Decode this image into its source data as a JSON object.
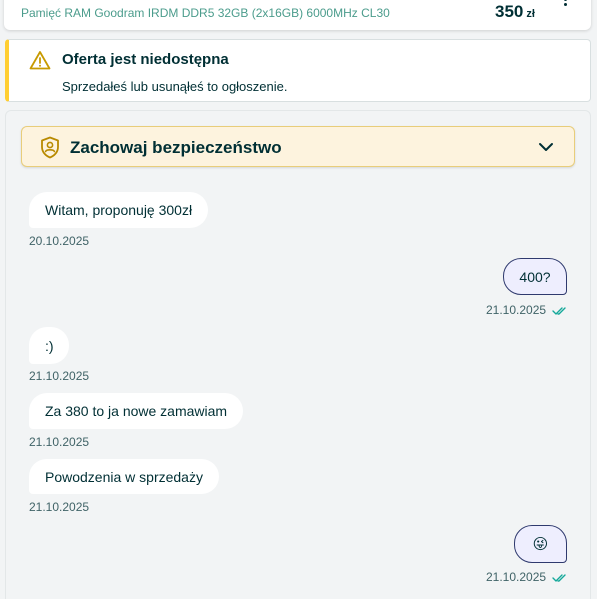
{
  "offer": {
    "title": "Pamięć RAM Goodram IRDM DDR5 32GB (2x16GB) 6000MHz CL30",
    "price": "350",
    "currency": "zł"
  },
  "notice": {
    "title": "Oferta jest niedostępna",
    "text": "Sprzedałeś lub usunąłeś to ogłoszenie."
  },
  "safety": {
    "title": "Zachowaj bezpieczeństwo"
  },
  "messages": [
    {
      "direction": "incoming",
      "text": "Witam, proponuję 300zł",
      "date": "20.10.2025"
    },
    {
      "direction": "outgoing",
      "text": "400?",
      "date": "21.10.2025",
      "read": true
    },
    {
      "direction": "incoming",
      "text": ":)",
      "date": "21.10.2025"
    },
    {
      "direction": "incoming",
      "text": "Za 380 to ja nowe zamawiam",
      "date": "21.10.2025"
    },
    {
      "direction": "incoming",
      "text": "Powodzenia w sprzedaży",
      "date": "21.10.2025"
    },
    {
      "direction": "outgoing",
      "text": "😜",
      "date": "21.10.2025",
      "read": true
    }
  ],
  "colors": {
    "accent_teal": "#4b9c8c",
    "warning_yellow": "#ffce32",
    "outgoing_bubble": "#eeeefe",
    "read_tick": "#14a89a"
  }
}
